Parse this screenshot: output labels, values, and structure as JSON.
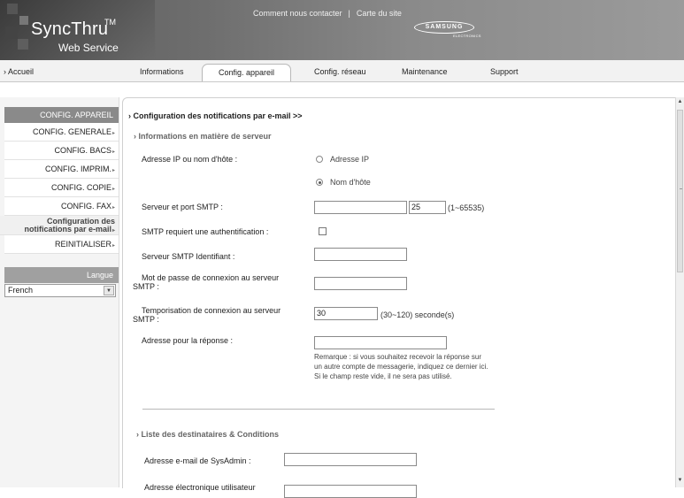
{
  "header": {
    "brand": "SyncThru",
    "brand_tm": "TM",
    "brand_sub": "Web Service",
    "links": [
      "Comment nous contacter",
      "Carte du site"
    ],
    "separator": "|",
    "vendor": "SAMSUNG",
    "vendor_sub": "ELECTRONICS"
  },
  "nav": {
    "home": "Accueil",
    "tabs": [
      "Informations",
      "Config. appareil",
      "Config. réseau",
      "Maintenance",
      "Support"
    ],
    "active_tab": "Config. appareil"
  },
  "sidebar": {
    "section_title": "CONFIG. APPAREIL",
    "items": [
      {
        "label": "CONFIG. GENERALE"
      },
      {
        "label": "CONFIG. BACS"
      },
      {
        "label": "CONFIG. IMPRIM."
      },
      {
        "label": "CONFIG. COPIE"
      },
      {
        "label": "CONFIG. FAX"
      },
      {
        "label": "Configuration des notifications par e-mail"
      },
      {
        "label": "REINITIALISER"
      }
    ],
    "language_title": "Langue",
    "language_value": "French"
  },
  "main": {
    "title": "Configuration des notifications par e-mail >>",
    "server_section": "Informations en matière de serveur",
    "host_label": "Adresse IP ou nom d'hôte :",
    "radio_ip": "Adresse IP",
    "radio_host": "Nom d'hôte",
    "smtp_label": "Serveur et port SMTP :",
    "smtp_port": "25",
    "smtp_port_range": "(1~65535)",
    "auth_label": "SMTP requiert une authentification :",
    "smtp_id_label": "Serveur SMTP Identifiant :",
    "password_label": "Mot de passe de connexion au serveur SMTP :",
    "timeout_label": "Temporisation de connexion au serveur SMTP :",
    "timeout_value": "30",
    "timeout_range": "(30~120) seconde(s)",
    "reply_label": "Adresse pour la réponse :",
    "reply_note": "Remarque : si vous souhaitez recevoir la réponse sur un autre compte de messagerie, indiquez ce dernier ici. Si le champ reste vide, il ne sera pas utilisé.",
    "recipients_section": "Liste des destinataires & Conditions",
    "sysadmin_label": "Adresse e-mail de SysAdmin :",
    "user_email_label": "Adresse électronique utilisateur"
  }
}
